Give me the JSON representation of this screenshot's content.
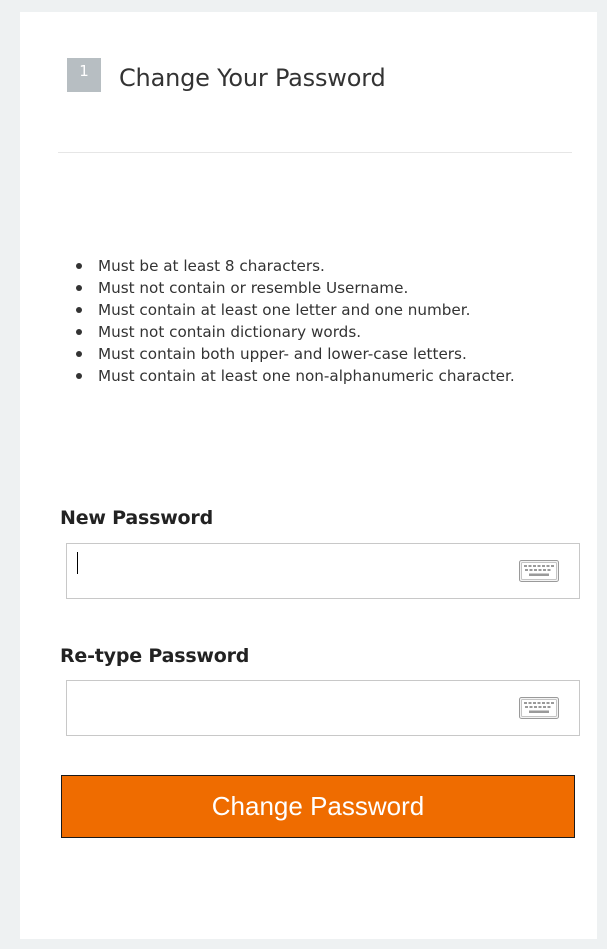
{
  "step": {
    "number": "1",
    "title": "Change Your Password"
  },
  "rules": [
    "Must be at least 8 characters.",
    "Must not contain or resemble Username.",
    "Must contain at least one letter and one number.",
    "Must not contain dictionary words.",
    "Must contain both upper- and lower-case letters.",
    "Must contain at least one non-alphanumeric character."
  ],
  "fields": {
    "new_password": {
      "label": "New Password",
      "value": "",
      "placeholder": ""
    },
    "retype_password": {
      "label": "Re-type Password",
      "value": "",
      "placeholder": ""
    }
  },
  "icons": {
    "keyboard": "keyboard-icon"
  },
  "submit": {
    "label": "Change Password"
  },
  "colors": {
    "accent": "#ef6c00",
    "step_badge": "#b7bec2",
    "background": "#eef1f2"
  }
}
